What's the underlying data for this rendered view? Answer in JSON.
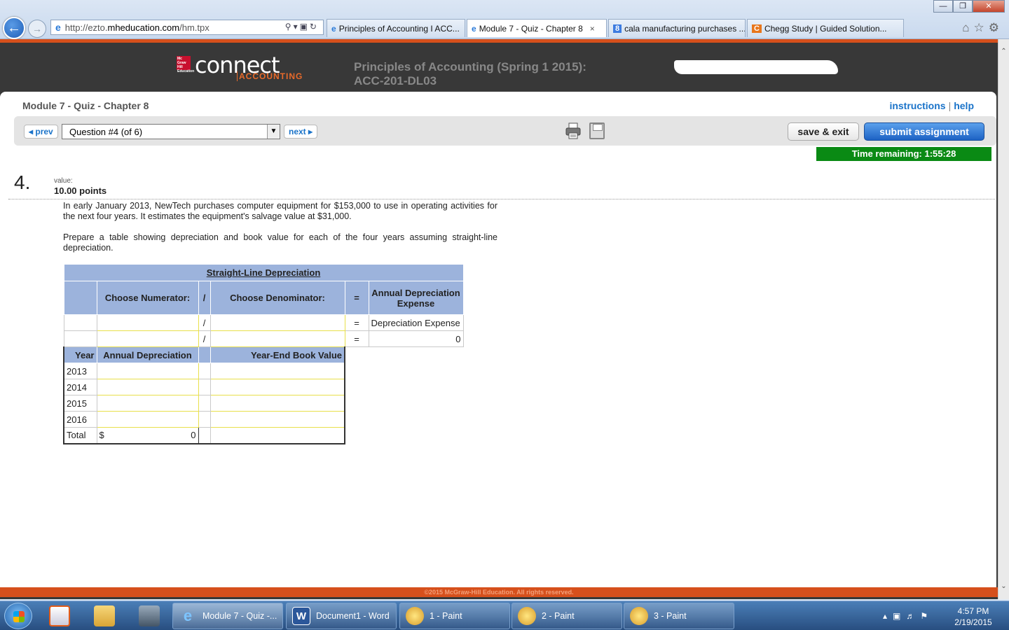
{
  "browser": {
    "url_prefix": "http://ezto.",
    "url_domain": "mheducation.com",
    "url_path": "/hm.tpx",
    "tabs": [
      {
        "label": "Principles of Accounting I ACC...",
        "icon": "ie-icon"
      },
      {
        "label": "Module 7 - Quiz - Chapter 8",
        "icon": "ie-icon",
        "active": true
      },
      {
        "label": "cala manufacturing purchases ...",
        "icon": "google-icon"
      },
      {
        "label": "Chegg Study | Guided Solution...",
        "icon": "chegg-icon"
      }
    ],
    "tab_close": "×"
  },
  "header": {
    "logo_text": "connect",
    "logo_sub": "ACCOUNTING",
    "mh_badge": "Mc Graw Hill Education",
    "course_line1": "Principles of Accounting (Spring 1 2015):",
    "course_line2": "ACC-201-DL03"
  },
  "quiz": {
    "title": "Module 7 - Quiz - Chapter 8",
    "instructions": "instructions",
    "help": "help",
    "help_sep": "|",
    "prev": "◂ prev",
    "next": "next ▸",
    "question_select": "Question #4 (of 6)",
    "save_exit": "save & exit",
    "submit": "submit assignment",
    "timer": "Time remaining: 1:55:28"
  },
  "question": {
    "number": "4.",
    "value_label": "value:",
    "points": "10.00 points",
    "para1": "In early January 2013, NewTech purchases computer equipment for $153,000 to use in operating activities for the next four years. It estimates the equipment's salvage value at $31,000.",
    "para2": "Prepare a table showing depreciation and book value for each of the four years assuming straight-line depreciation."
  },
  "table": {
    "title": "Straight-Line Depreciation",
    "numerator_label": "Choose Numerator:",
    "slash": "/",
    "denominator_label": "Choose Denominator:",
    "equals": "=",
    "result_label": "Annual Depreciation Expense",
    "row1_result": "Depreciation Expense",
    "row2_result": "0",
    "col_year": "Year",
    "col_annual": "Annual Depreciation",
    "col_book": "Year-End Book Value",
    "years": [
      "2013",
      "2014",
      "2015",
      "2016"
    ],
    "total_label": "Total",
    "total_currency": "$",
    "total_value": "0"
  },
  "footer": {
    "copyright": "©2015 McGraw-Hill Education. All rights reserved."
  },
  "taskbar": {
    "items": [
      {
        "label": "Module 7 - Quiz -...",
        "active": true
      },
      {
        "label": "Document1 - Word"
      },
      {
        "label": "1 - Paint"
      },
      {
        "label": "2 - Paint"
      },
      {
        "label": "3 - Paint"
      }
    ],
    "time": "4:57 PM",
    "date": "2/19/2015"
  }
}
